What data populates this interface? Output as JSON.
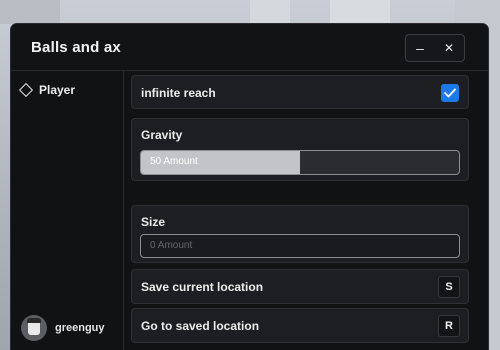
{
  "window": {
    "title": "Balls and ax",
    "minimize_symbol": "–",
    "close_symbol": "✕"
  },
  "sidebar": {
    "items": [
      {
        "label": "Player",
        "icon": "diamond-icon"
      }
    ],
    "user": {
      "name": "greenguy",
      "icon": "avatar"
    }
  },
  "main": {
    "infinite_reach": {
      "label": "infinite reach",
      "checked": true
    },
    "gravity": {
      "label": "Gravity",
      "value_text": "50 Amount",
      "fill": 0.5
    },
    "size": {
      "label": "Size",
      "placeholder": "0 Amount"
    },
    "save_location": {
      "label": "Save current location",
      "key": "S"
    },
    "goto_location": {
      "label": "Go to saved location",
      "key": "R"
    }
  },
  "colors": {
    "accent": "#1c7ae8",
    "panel": "#1d1e21",
    "background": "#111214"
  }
}
